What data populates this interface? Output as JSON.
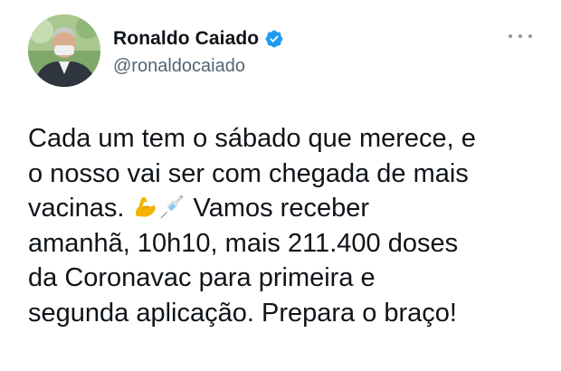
{
  "author": {
    "name": "Ronaldo Caiado",
    "handle": "@ronaldocaiado",
    "verified": true
  },
  "icons": {
    "more": "more-options-icon",
    "verified": "verified-badge-icon",
    "emoji_1": "flexed-biceps-emoji",
    "emoji_2": "syringe-emoji"
  },
  "tweet": {
    "line1": "Cada um tem o sábado que merece, e",
    "line2": "o nosso vai ser com chegada de mais",
    "line3_before": "vacinas.",
    "line3_after": "Vamos receber",
    "line4": "amanhã, 10h10, mais 211.400 doses",
    "line5": "da Coronavac para primeira e",
    "line6": "segunda aplicação. Prepara o braço!"
  },
  "colors": {
    "text": "#0f1419",
    "secondary": "#536471",
    "verified_blue": "#1d9bf0"
  }
}
